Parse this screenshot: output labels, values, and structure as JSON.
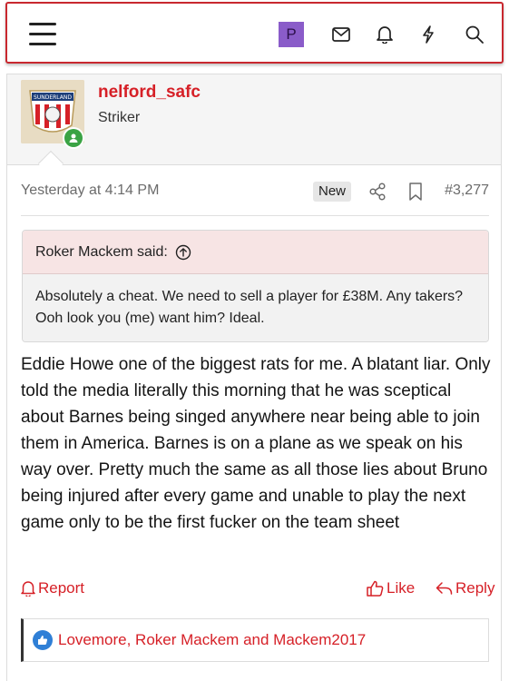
{
  "navbar": {
    "user_initial": "P",
    "icons": [
      "menu-icon",
      "mail-icon",
      "bell-icon",
      "lightning-icon",
      "search-icon"
    ]
  },
  "post": {
    "username": "nelford_safc",
    "user_title": "Striker",
    "avatar_crest_text": "SUNDERLAND",
    "timestamp": "Yesterday at 4:14 PM",
    "badge": "New",
    "post_number": "#3,277",
    "quote": {
      "author": "Roker Mackem said:",
      "text": "Absolutely a cheat. We need to sell a player for £38M. Any takers? Ooh look you (me) want him? Ideal."
    },
    "message": "Eddie Howe one of the biggest rats for me. A blatant liar. Only told the media literally this morning that he was sceptical about Barnes being singed anywhere near being able to join them in America. Barnes is on a plane as we speak on his way over. Pretty much the same as all those lies about Bruno being injured after every game and unable to play the next game only to be the first fucker on the team sheet",
    "actions": {
      "report": "Report",
      "like": "Like",
      "reply": "Reply"
    },
    "reactions": {
      "names": "Lovemore, Roker Mackem and Mackem2017"
    }
  },
  "colors": {
    "accent": "#d62027",
    "online": "#3aa344",
    "like": "#2f7fd6",
    "quote_head_bg": "#f7e4e4"
  }
}
